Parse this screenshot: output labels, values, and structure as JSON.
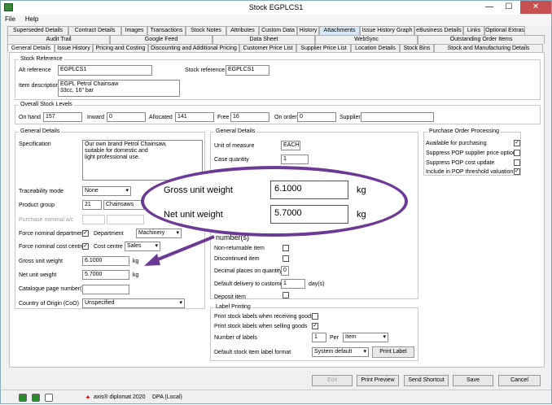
{
  "window": {
    "title": "Stock EGPLCS1",
    "min": "—",
    "max": "☐",
    "close": "✕"
  },
  "menu": [
    "File",
    "Help"
  ],
  "tabs_row1": [
    "Superseded Details",
    "Contract Details",
    "Images",
    "Transactions",
    "Stock Notes",
    "Attributes",
    "Custom Data",
    "History",
    "Attachments",
    "Issue History Graph",
    "eBusiness Details",
    "Links",
    "Optional Extras"
  ],
  "tabs_row2": [
    "Audit Trail",
    "Google Feed",
    "Data Sheet",
    "WebSync",
    "Outstanding Order Items"
  ],
  "tabs_row3": [
    "General Details",
    "Issue History",
    "Pricing and Costing",
    "Discounting and Additional Pricing",
    "Customer Price List",
    "Supplier Price List",
    "Location Details",
    "Stock Bins",
    "Stock and Manufacturing Details"
  ],
  "stock_ref": {
    "group": "Stock Reference",
    "alt_label": "Alt reference",
    "alt_value": "EGPLCS1",
    "ref_label": "Stock reference",
    "ref_value": "EGPLCS1",
    "desc_label": "Item description",
    "desc_value": "EGPL Petrol Chainsaw\n33cc, 16\" bar"
  },
  "levels": {
    "group": "Overall Stock Levels",
    "on_hand_label": "On hand",
    "on_hand": "157",
    "inward_label": "Inward",
    "inward": "0",
    "allocated_label": "Allocated",
    "allocated": "141",
    "free_label": "Free",
    "free": "16",
    "on_order_label": "On order",
    "on_order": "0",
    "supplier_label": "Supplier",
    "supplier": ""
  },
  "general": {
    "group": "General Details",
    "spec_label": "Specification",
    "spec_value": "Our own brand Petrol Chainsaw,\nsuitable for domestic and\nlight professional use.",
    "trace_label": "Traceability mode",
    "trace_value": "None",
    "pgroup_label": "Product group",
    "pgroup_code": "21",
    "pgroup_name": "Chainsaws",
    "purch_nominal_label": "Purchase nominal a/c",
    "force_dept_label": "Force nominal department",
    "dept_label": "Department",
    "dept_value": "Machinery",
    "force_cc_label": "Force nominal cost centre",
    "cc_label": "Cost centre",
    "cc_value": "Sales",
    "gross_label": "Gross unit weight",
    "gross_value": "6.1000",
    "gross_unit": "kg",
    "net_label": "Net unit weight",
    "net_value": "5.7000",
    "net_unit": "kg",
    "catalogue_label": "Catalogue page number(s)",
    "origin_label": "Country of Origin (CoO)",
    "origin_value": "Unspecified"
  },
  "gd2": {
    "group": "General Details",
    "uom_label": "Unit of measure",
    "uom_value": "EACH",
    "case_label": "Case quantity",
    "case_value": "1",
    "partial_label": "number(s)",
    "nonret_label": "Non-returnable item",
    "discont_label": "Discontinued item",
    "decimal_label": "Decimal places on quantity",
    "decimal_value": "0",
    "delivery_label": "Default delivery to customer",
    "delivery_value": "1",
    "delivery_unit": "day(s)",
    "deposit_label": "Deposit item"
  },
  "po": {
    "group": "Purchase Order Processing",
    "items": [
      "Available for purchasing",
      "Suppress POP supplier price options",
      "Suppress POP cost update",
      "Include in POP threshold valuation"
    ],
    "checked": [
      true,
      false,
      false,
      true
    ]
  },
  "label_printing": {
    "group": "Label Printing",
    "recv_label": "Print stock labels when receiving goods",
    "sell_label": "Print stock labels when selling goods",
    "num_label": "Number of labels",
    "num_value": "1",
    "per_label": "Per",
    "per_value": "Item",
    "format_label": "Default stock item label format",
    "format_value": "System default",
    "print_button": "Print Label"
  },
  "buttons": {
    "edit": "Edit",
    "preview": "Print Preview",
    "shortcut": "Send Shortcut",
    "save": "Save",
    "cancel": "Cancel"
  },
  "status": {
    "app": "axis® diplomat 2020",
    "db": "DPA (Local)"
  },
  "callout": {
    "gross_label": "Gross unit weight",
    "gross_value": "6.1000",
    "gross_unit": "kg",
    "net_label": "Net unit weight",
    "net_value": "5.7000",
    "net_unit": "kg"
  },
  "colors": {
    "callout": "#6b3a96",
    "close": "#c75050"
  }
}
